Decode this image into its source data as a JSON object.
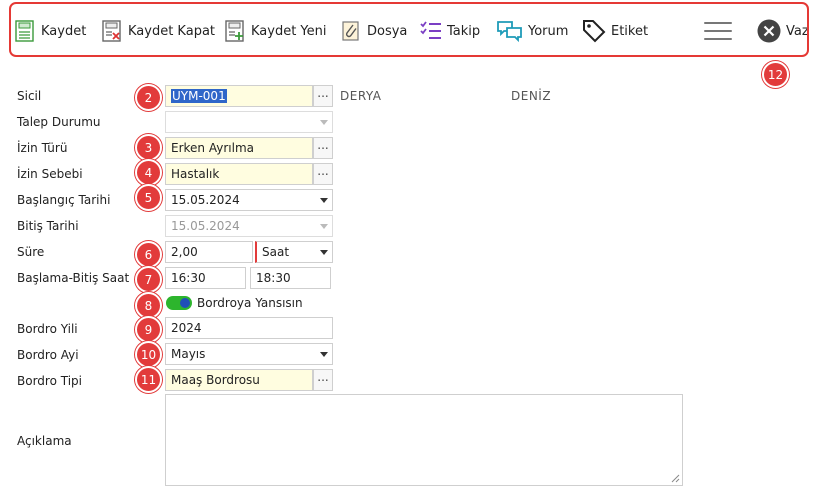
{
  "toolbar": {
    "save": "Kaydet",
    "save_close": "Kaydet Kapat",
    "save_new": "Kaydet Yeni",
    "file": "Dosya",
    "follow": "Takip",
    "comment": "Yorum",
    "tag": "Etiket",
    "cancel": "Vazg"
  },
  "markers": [
    "2",
    "3",
    "4",
    "5",
    "6",
    "7",
    "8",
    "9",
    "10",
    "11",
    "12"
  ],
  "form": {
    "sicil": {
      "label": "Sicil",
      "value": "UYM-001",
      "first_name": "DERYA",
      "last_name": "DENİZ"
    },
    "talep_durumu": {
      "label": "Talep Durumu",
      "value": ""
    },
    "izin_turu": {
      "label": "İzin Türü",
      "value": "Erken Ayrılma"
    },
    "izin_sebebi": {
      "label": "İzin Sebebi",
      "value": "Hastalık"
    },
    "baslangic_tarihi": {
      "label": "Başlangıç Tarihi",
      "value": "15.05.2024"
    },
    "bitis_tarihi": {
      "label": "Bitiş Tarihi",
      "value": "15.05.2024"
    },
    "sure": {
      "label": "Süre",
      "value": "2,00",
      "unit": "Saat"
    },
    "baslama_bitis_saat": {
      "label": "Başlama-Bitiş Saat",
      "start": "16:30",
      "end": "18:30"
    },
    "bordro_yansisin": {
      "label": "Bordroya Yansısın",
      "checked": true
    },
    "bordro_yili": {
      "label": "Bordro Yili",
      "value": "2024"
    },
    "bordro_ayi": {
      "label": "Bordro Ayi",
      "value": "Mayıs"
    },
    "bordro_tipi": {
      "label": "Bordro Tipi",
      "value": "Maaş Bordrosu"
    },
    "aciklama": {
      "label": "Açıklama",
      "value": ""
    }
  },
  "colors": {
    "accent_red": "#e23b3b",
    "toggle_on": "#2db52d",
    "selection": "#2f66c9",
    "lookup_bg": "#fffde0"
  }
}
